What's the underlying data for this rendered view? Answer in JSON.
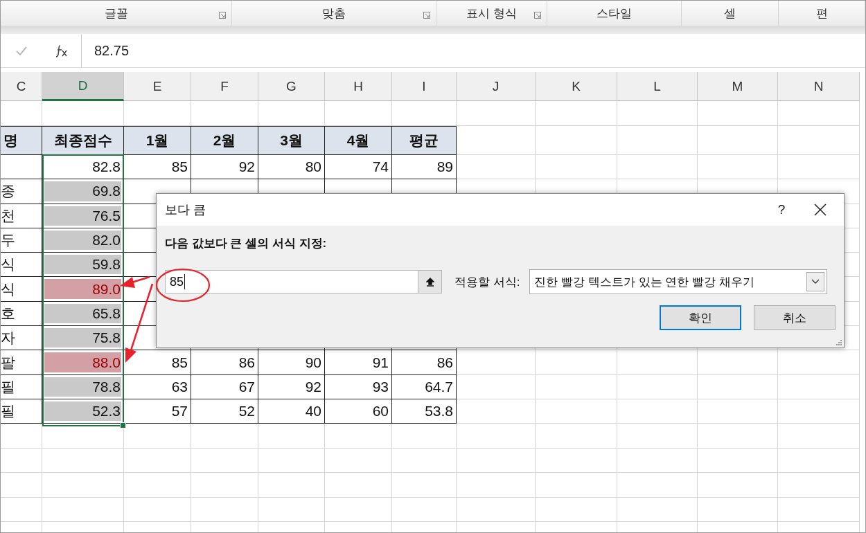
{
  "ribbon": {
    "groups": [
      {
        "label": "글꼴",
        "launcher": true
      },
      {
        "label": "맞춤",
        "launcher": true
      },
      {
        "label": "표시 형식",
        "launcher": true
      },
      {
        "label": "스타일",
        "launcher": false
      },
      {
        "label": "셀",
        "launcher": false
      },
      {
        "label": "편",
        "launcher": false
      }
    ]
  },
  "formula_bar": {
    "value": "82.75"
  },
  "sheet": {
    "columns": [
      {
        "label": "C",
        "selected": false
      },
      {
        "label": "D",
        "selected": true
      },
      {
        "label": "E",
        "selected": false
      },
      {
        "label": "F",
        "selected": false
      },
      {
        "label": "G",
        "selected": false
      },
      {
        "label": "H",
        "selected": false
      },
      {
        "label": "I",
        "selected": false
      },
      {
        "label": "J",
        "selected": false
      },
      {
        "label": "K",
        "selected": false
      },
      {
        "label": "L",
        "selected": false
      },
      {
        "label": "M",
        "selected": false
      },
      {
        "label": "N",
        "selected": false
      }
    ],
    "header": [
      "명",
      "최종점수",
      "1월",
      "2월",
      "3월",
      "4월",
      "평균"
    ],
    "rows": [
      {
        "name": "",
        "score": "82.8",
        "kind": "active",
        "months": [
          "85",
          "92",
          "80",
          "74",
          "89"
        ]
      },
      {
        "name": "종",
        "score": "69.8",
        "kind": "shaded"
      },
      {
        "name": "천",
        "score": "76.5",
        "kind": "shaded"
      },
      {
        "name": "두",
        "score": "82.0",
        "kind": "shaded"
      },
      {
        "name": "식",
        "score": "59.8",
        "kind": "shaded"
      },
      {
        "name": "식",
        "score": "89.0",
        "kind": "flagged"
      },
      {
        "name": "호",
        "score": "65.8",
        "kind": "shaded"
      },
      {
        "name": "자",
        "score": "75.8",
        "kind": "shaded"
      },
      {
        "name": "팔",
        "score": "88.0",
        "kind": "flagged",
        "months": [
          "85",
          "86",
          "90",
          "91",
          "86"
        ]
      },
      {
        "name": "필",
        "score": "78.8",
        "kind": "shaded",
        "months": [
          "63",
          "67",
          "92",
          "93",
          "64.7"
        ]
      },
      {
        "name": "필",
        "score": "52.3",
        "kind": "shaded",
        "months": [
          "57",
          "52",
          "40",
          "60",
          "53.8"
        ]
      }
    ]
  },
  "dialog": {
    "title": "보다 큼",
    "help": "?",
    "prompt": "다음 값보다 큰 셀의 서식 지정:",
    "value": "85",
    "format_label": "적용할 서식:",
    "format_value": "진한 빨강 텍스트가 있는 연한 빨강 채우기",
    "buttons": [
      {
        "label": "확인",
        "default": true
      },
      {
        "label": "취소",
        "default": false
      }
    ]
  }
}
